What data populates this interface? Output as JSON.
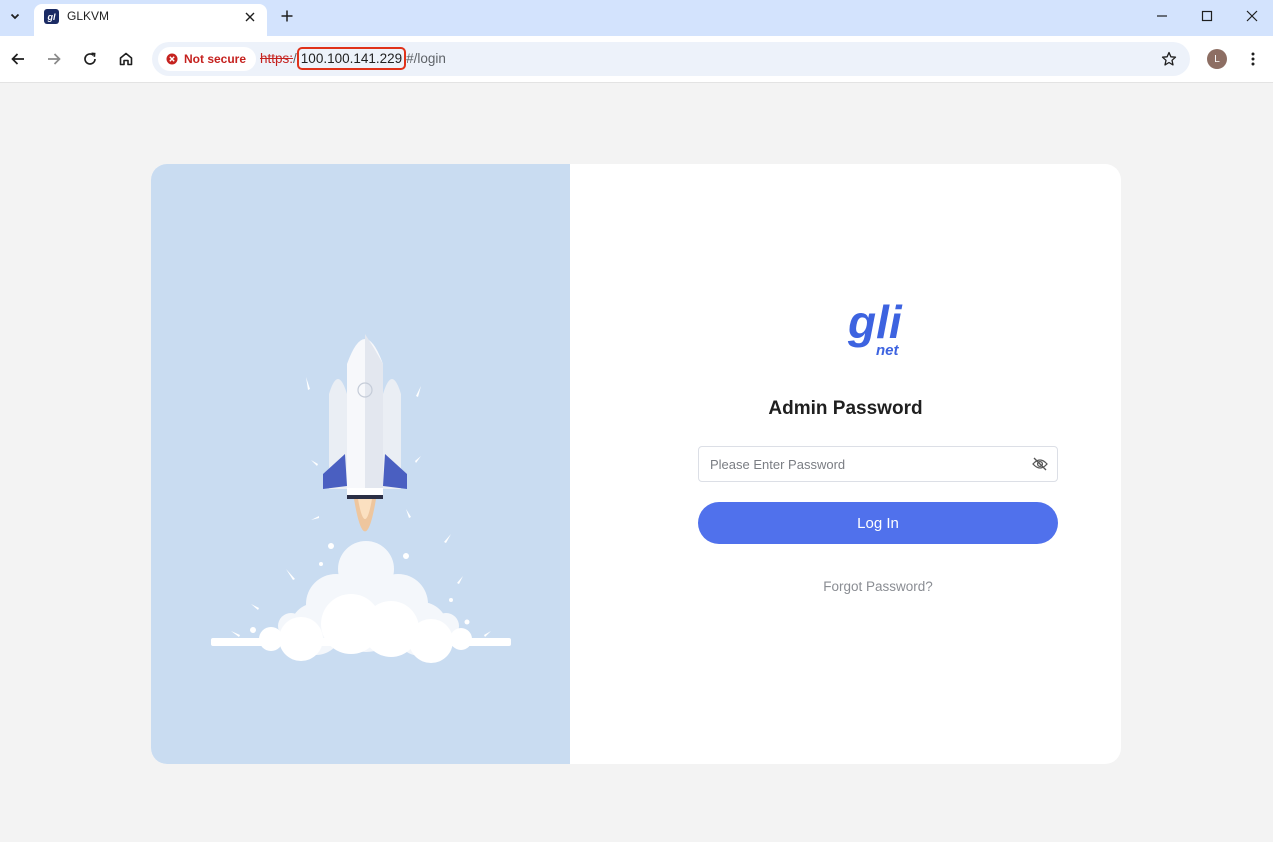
{
  "browser": {
    "tab": {
      "title": "GLKVM",
      "favicon_text": "gl"
    },
    "address": {
      "security_label": "Not secure",
      "scheme": "https:",
      "separator": "/",
      "host": "100.100.141.229",
      "path": "#/login"
    },
    "profile_initial": "L"
  },
  "login": {
    "logo_text_main": "gli",
    "logo_text_sub": "net",
    "title": "Admin Password",
    "password_placeholder": "Please Enter Password",
    "password_value": "",
    "login_button": "Log In",
    "forgot_link": "Forgot Password?"
  },
  "colors": {
    "primary": "#5071ec",
    "illustration_bg": "#c9dcf1",
    "warning_red": "#c5221f",
    "logo_blue": "#3d63e0"
  },
  "icons": {
    "tab_search": "chevron-down-icon",
    "close": "close-icon",
    "new_tab": "plus-icon",
    "back": "arrow-left-icon",
    "forward": "arrow-right-icon",
    "reload": "reload-icon",
    "home": "home-icon",
    "security": "warning-icon",
    "bookmark": "star-icon",
    "menu": "kebab-icon",
    "password_visibility": "eye-off-icon"
  }
}
